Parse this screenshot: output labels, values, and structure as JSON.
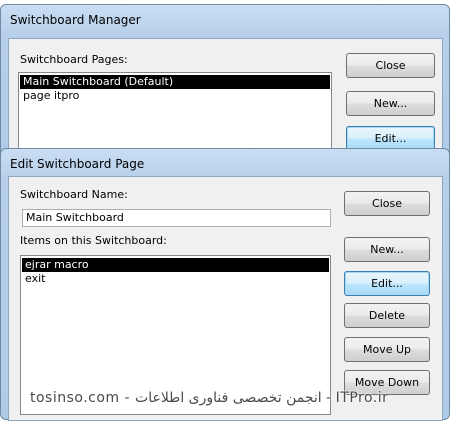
{
  "manager": {
    "title": "Switchboard Manager",
    "pages_label": "Switchboard Pages:",
    "pages": [
      {
        "label": "Main Switchboard (Default)",
        "selected": true
      },
      {
        "label": "page itpro",
        "selected": false
      }
    ],
    "buttons": {
      "close": "Close",
      "new": "New...",
      "edit": "Edit..."
    }
  },
  "edit_page": {
    "title": "Edit Switchboard Page",
    "name_label": "Switchboard Name:",
    "name_value": "Main Switchboard",
    "items_label": "Items on this Switchboard:",
    "items": [
      {
        "label": "ejrar macro",
        "selected": true
      },
      {
        "label": "exit",
        "selected": false
      }
    ],
    "buttons": {
      "close": "Close",
      "new": "New...",
      "edit": "Edit...",
      "delete": "Delete",
      "move_up": "Move Up",
      "move_down": "Move Down"
    }
  },
  "watermark": "tosinso.com - انجمن تخصصی فناوری اطلاعات - ITPro.ir"
}
